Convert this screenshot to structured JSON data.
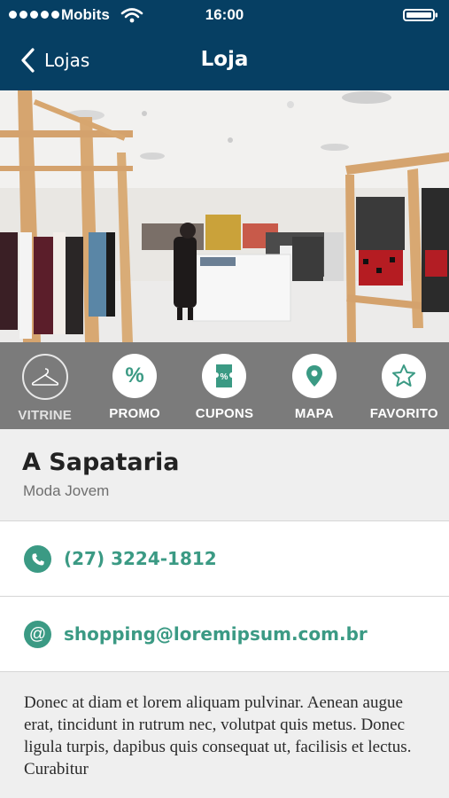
{
  "status_bar": {
    "carrier": "Mobits",
    "time": "16:00",
    "icons": [
      "signal-dots",
      "wifi-icon",
      "battery-icon"
    ]
  },
  "nav": {
    "back_label": "Lojas",
    "title": "Loja",
    "icons": [
      "chevron-left-icon"
    ]
  },
  "hero": {
    "description_icon": "store-photo"
  },
  "actions": [
    {
      "label": "VITRINE",
      "icon": "hanger-icon",
      "active": false
    },
    {
      "label": "PROMO",
      "icon": "percent-icon",
      "active": true
    },
    {
      "label": "CUPONS",
      "icon": "coupon-icon",
      "active": true
    },
    {
      "label": "MAPA",
      "icon": "map-pin-icon",
      "active": true
    },
    {
      "label": "FAVORITO",
      "icon": "star-icon",
      "active": true
    }
  ],
  "store": {
    "name": "A Sapataria",
    "category": "Moda Jovem",
    "phone": "(27) 3224-1812",
    "email": "shopping@loremipsum.com.br",
    "description": "Donec at diam et lorem aliquam pulvinar. Aenean augue erat, tincidunt in rutrum nec, volutpat quis metus. Donec ligula turpis, dapibus quis consequat ut, facilisis et lectus. Curabitur"
  },
  "colors": {
    "header_bg": "#063f63",
    "accent": "#3b9a84",
    "action_bar_bg": "#7b7b7b",
    "page_bg": "#efefef"
  }
}
